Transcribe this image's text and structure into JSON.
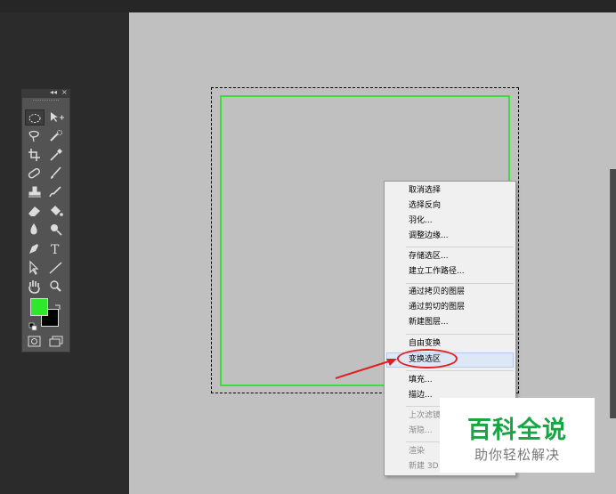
{
  "toolbox": {
    "collapse_glyph": "◂◂",
    "close_glyph": "×",
    "tools": [
      {
        "icon": "elliptical-marquee-icon"
      },
      {
        "icon": "move-icon"
      },
      {
        "icon": "lasso-icon"
      },
      {
        "icon": "quick-selection-icon"
      },
      {
        "icon": "crop-icon"
      },
      {
        "icon": "eyedropper-icon"
      },
      {
        "icon": "healing-brush-icon"
      },
      {
        "icon": "brush-icon"
      },
      {
        "icon": "clone-stamp-icon"
      },
      {
        "icon": "history-brush-icon"
      },
      {
        "icon": "eraser-icon"
      },
      {
        "icon": "paint-bucket-icon"
      },
      {
        "icon": "blur-icon"
      },
      {
        "icon": "dodge-icon"
      },
      {
        "icon": "pen-icon"
      },
      {
        "icon": "type-icon",
        "glyph": "T"
      },
      {
        "icon": "path-selection-icon"
      },
      {
        "icon": "line-icon"
      },
      {
        "icon": "hand-icon"
      },
      {
        "icon": "zoom-icon"
      }
    ],
    "foreground_color": "#2ee82e",
    "background_color": "#000000"
  },
  "context_menu": {
    "items": [
      {
        "label": "取消选择",
        "disabled": false
      },
      {
        "label": "选择反向",
        "disabled": false
      },
      {
        "label": "羽化...",
        "disabled": false
      },
      {
        "label": "调整边缘...",
        "disabled": false
      },
      {
        "label": "存储选区...",
        "disabled": false
      },
      {
        "label": "建立工作路径...",
        "disabled": false
      },
      {
        "label": "通过拷贝的图层",
        "disabled": false
      },
      {
        "label": "通过剪切的图层",
        "disabled": false
      },
      {
        "label": "新建图层...",
        "disabled": false
      },
      {
        "label": "自由变换",
        "disabled": false
      },
      {
        "label": "变换选区",
        "disabled": false,
        "highlighted": true
      },
      {
        "label": "填充...",
        "disabled": false
      },
      {
        "label": "描边...",
        "disabled": false
      },
      {
        "label": "上次滤镜",
        "disabled": true
      },
      {
        "label": "渐隐...",
        "disabled": true
      },
      {
        "label": "渲染",
        "disabled": true
      },
      {
        "label": "新建 3D",
        "disabled": true
      }
    ]
  },
  "annotation": {
    "color": "#e02020"
  },
  "watermark": {
    "title": "百科全说",
    "subtitle": "助你轻松解决"
  }
}
